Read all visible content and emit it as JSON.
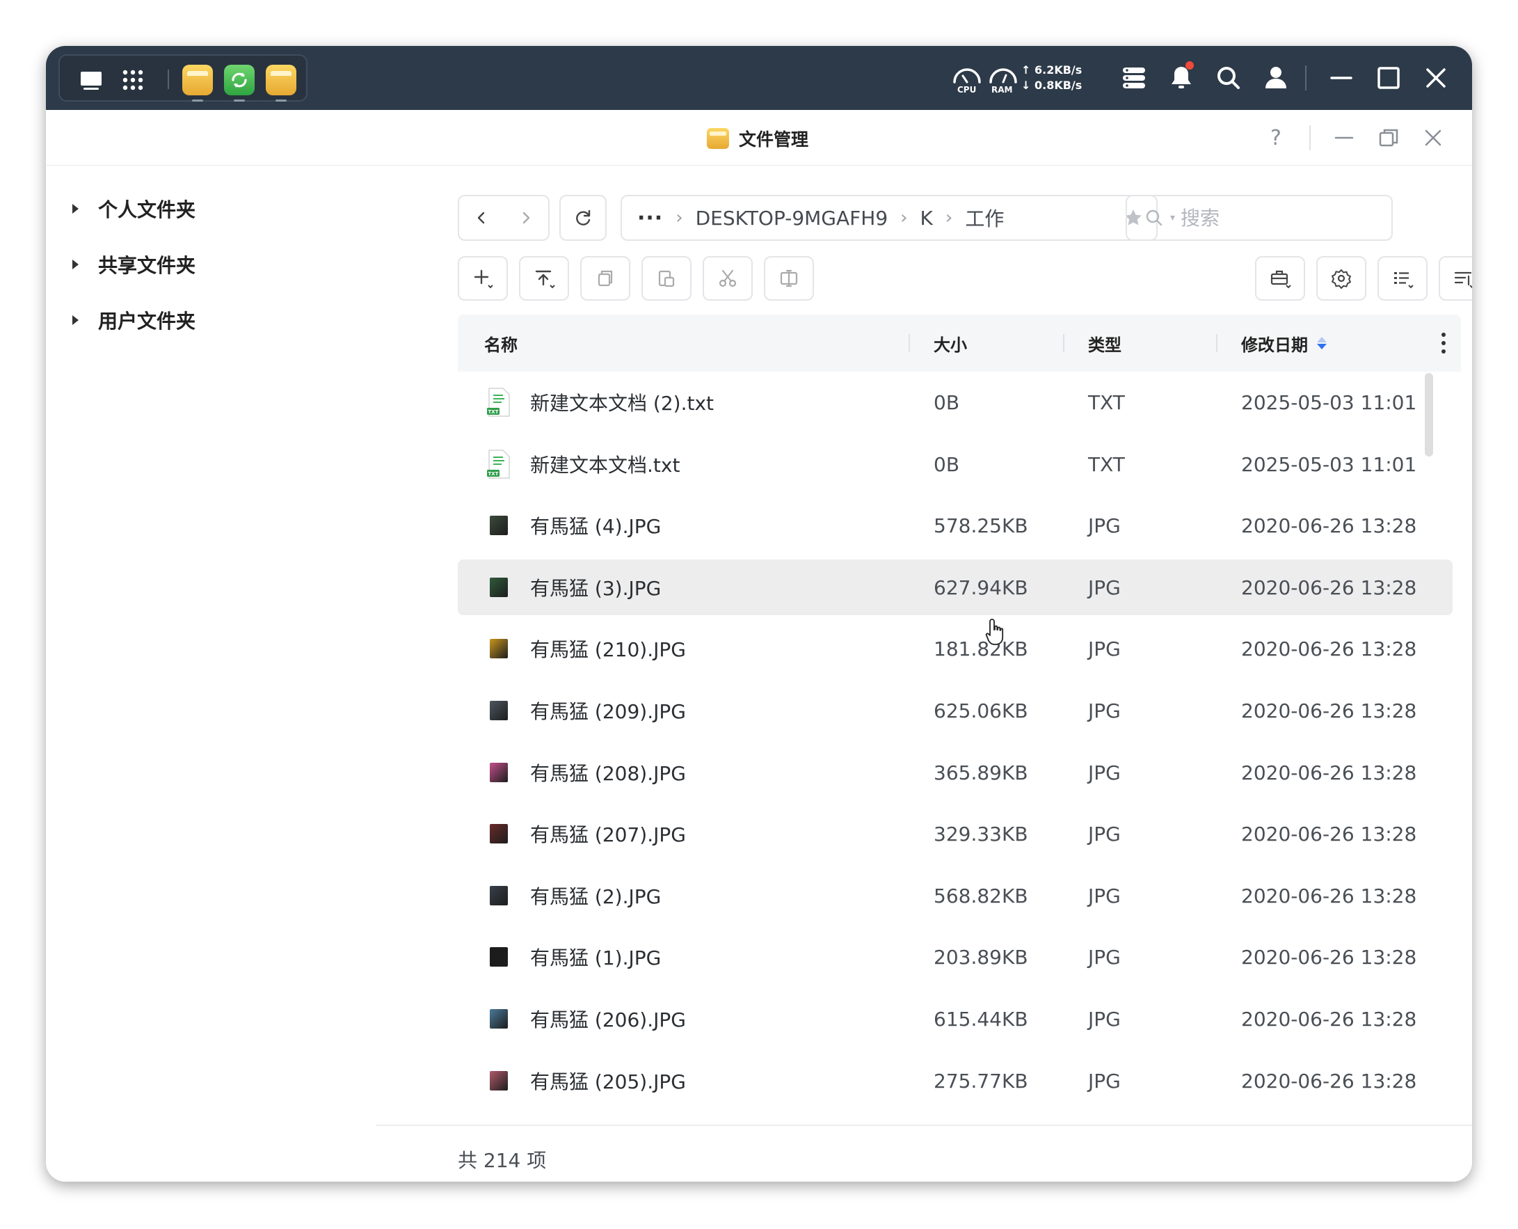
{
  "topbar": {
    "net_up": "6.2KB/s",
    "net_down": "0.8KB/s",
    "cpu_label": "CPU",
    "ram_label": "RAM"
  },
  "window": {
    "title": "文件管理"
  },
  "sidebar": {
    "items": [
      {
        "label": "个人文件夹"
      },
      {
        "label": "共享文件夹"
      },
      {
        "label": "用户文件夹"
      }
    ]
  },
  "breadcrumb": {
    "more": "···",
    "parts": [
      "DESKTOP-9MGAFH9",
      "K",
      "工作"
    ]
  },
  "search": {
    "placeholder": "搜索"
  },
  "table": {
    "headers": {
      "name": "名称",
      "size": "大小",
      "type": "类型",
      "modified": "修改日期"
    },
    "rows": [
      {
        "name": "新建文本文档 (2).txt",
        "size": "0B",
        "type": "TXT",
        "modified": "2025-05-03 11:01",
        "kind": "txt"
      },
      {
        "name": "新建文本文档.txt",
        "size": "0B",
        "type": "TXT",
        "modified": "2025-05-03 11:01",
        "kind": "txt"
      },
      {
        "name": "有馬猛 (4).JPG",
        "size": "578.25KB",
        "type": "JPG",
        "modified": "2020-06-26 13:28",
        "kind": "jpg",
        "thumb": "#3b4a3a"
      },
      {
        "name": "有馬猛 (3).JPG",
        "size": "627.94KB",
        "type": "JPG",
        "modified": "2020-06-26 13:28",
        "kind": "jpg",
        "thumb": "#2f5a3a",
        "selected": true
      },
      {
        "name": "有馬猛 (210).JPG",
        "size": "181.82KB",
        "type": "JPG",
        "modified": "2020-06-26 13:28",
        "kind": "jpg",
        "thumb": "#c8951e"
      },
      {
        "name": "有馬猛 (209).JPG",
        "size": "625.06KB",
        "type": "JPG",
        "modified": "2020-06-26 13:28",
        "kind": "jpg",
        "thumb": "#4c5660"
      },
      {
        "name": "有馬猛 (208).JPG",
        "size": "365.89KB",
        "type": "JPG",
        "modified": "2020-06-26 13:28",
        "kind": "jpg",
        "thumb": "#c24f8a"
      },
      {
        "name": "有馬猛 (207).JPG",
        "size": "329.33KB",
        "type": "JPG",
        "modified": "2020-06-26 13:28",
        "kind": "jpg",
        "thumb": "#6a2a2a"
      },
      {
        "name": "有馬猛 (2).JPG",
        "size": "568.82KB",
        "type": "JPG",
        "modified": "2020-06-26 13:28",
        "kind": "jpg",
        "thumb": "#38404a"
      },
      {
        "name": "有馬猛 (1).JPG",
        "size": "203.89KB",
        "type": "JPG",
        "modified": "2020-06-26 13:28",
        "kind": "jpg",
        "thumb": "#1c1c1c"
      },
      {
        "name": "有馬猛 (206).JPG",
        "size": "615.44KB",
        "type": "JPG",
        "modified": "2020-06-26 13:28",
        "kind": "jpg",
        "thumb": "#4a7a9a"
      },
      {
        "name": "有馬猛 (205).JPG",
        "size": "275.77KB",
        "type": "JPG",
        "modified": "2020-06-26 13:28",
        "kind": "jpg",
        "thumb": "#b05a6a"
      }
    ]
  },
  "footer": {
    "count": "共 214 项"
  },
  "colors": {
    "topbar_bg": "#2d3a49",
    "accent": "#2f6ff0",
    "notify_dot": "#f04a3a"
  }
}
